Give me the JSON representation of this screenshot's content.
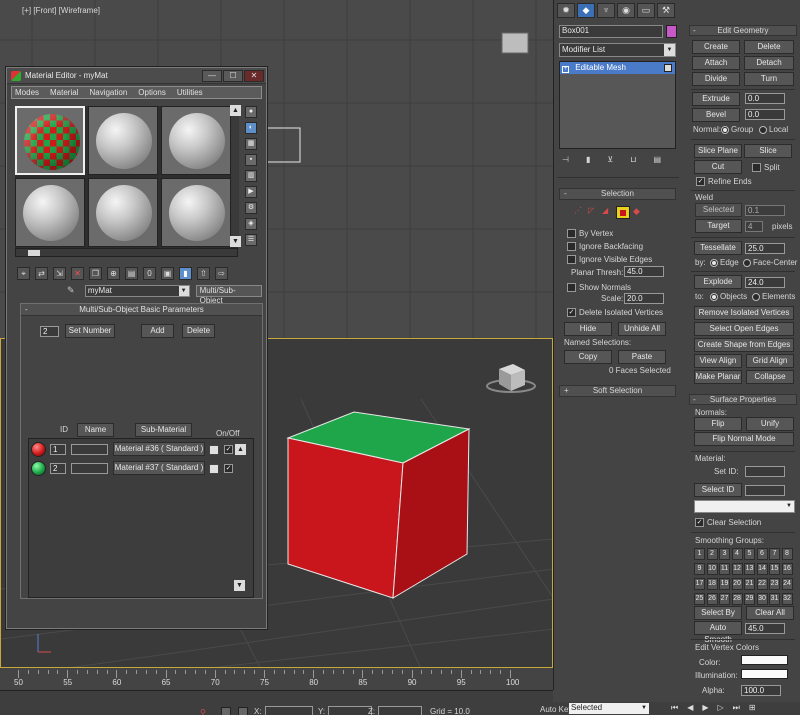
{
  "viewport_front": {
    "label": "[+] [Front] [Wireframe]"
  },
  "material_editor": {
    "title": "Material Editor - myMat",
    "menus": [
      "Modes",
      "Material",
      "Navigation",
      "Options",
      "Utilities"
    ],
    "material_name": "myMat",
    "material_type": "Multi/Sub-Object",
    "panel_title": "Multi/Sub-Object Basic Parameters",
    "count": "2",
    "set_number_label": "Set Number",
    "add_label": "Add",
    "delete_label": "Delete",
    "columns": {
      "id": "ID",
      "name": "Name",
      "submaterial": "Sub-Material",
      "onoff": "On/Off"
    },
    "rows": [
      {
        "id": "1",
        "name": "",
        "submaterial": "Material #36  ( Standard )",
        "ball_color": "#d21a1a"
      },
      {
        "id": "2",
        "name": "",
        "submaterial": "Material #37  ( Standard )",
        "ball_color": "#1fa64a"
      }
    ]
  },
  "command_panel": {
    "object_name": "Box001",
    "object_color": "#c658c8",
    "modifier_list": "Modifier List",
    "stack_item": "Editable Mesh",
    "selection": {
      "title": "Selection",
      "by_vertex": "By Vertex",
      "ignore_backfacing": "Ignore Backfacing",
      "ignore_visible_edges": "Ignore Visible Edges",
      "planar_thresh_label": "Planar Thresh:",
      "planar_thresh": "45.0",
      "show_normals": "Show Normals",
      "scale_label": "Scale:",
      "scale": "20.0",
      "delete_isolated": "Delete Isolated Vertices",
      "hide": "Hide",
      "unhide_all": "Unhide All",
      "named_selections": "Named Selections:",
      "copy": "Copy",
      "paste": "Paste",
      "faces_selected": "0 Faces Selected"
    },
    "soft_selection": "Soft Selection",
    "edit_geometry": {
      "title": "Edit Geometry",
      "create": "Create",
      "delete": "Delete",
      "attach": "Attach",
      "detach": "Detach",
      "divide": "Divide",
      "turn": "Turn",
      "extrude": "Extrude",
      "extrude_val": "0.0",
      "bevel": "Bevel",
      "bevel_val": "0.0",
      "normal_label": "Normal:",
      "group": "Group",
      "local": "Local",
      "slice_plane": "Slice Plane",
      "slice": "Slice",
      "cut": "Cut",
      "split": "Split",
      "refine_ends": "Refine Ends",
      "weld": "Weld",
      "selected": "Selected",
      "selected_val": "0.1",
      "target": "Target",
      "target_val": "4",
      "pixels": "pixels",
      "tessellate": "Tessellate",
      "tessellate_val": "25.0",
      "by_label": "by:",
      "edge": "Edge",
      "face_center": "Face-Center",
      "explode": "Explode",
      "explode_val": "24.0",
      "to_label": "to:",
      "objects": "Objects",
      "elements": "Elements",
      "remove_isolated": "Remove Isolated Vertices",
      "select_open_edges": "Select Open Edges",
      "create_shape": "Create Shape from Edges",
      "view_align": "View Align",
      "grid_align": "Grid Align",
      "make_planar": "Make Planar",
      "collapse": "Collapse"
    },
    "surface": {
      "title": "Surface Properties",
      "normals": "Normals:",
      "flip": "Flip",
      "unify": "Unify",
      "flip_normal_mode": "Flip Normal Mode",
      "material": "Material:",
      "set_id": "Set ID:",
      "select_id": "Select ID",
      "clear_selection": "Clear Selection",
      "smoothing_groups": "Smoothing Groups:",
      "sg": [
        "1",
        "2",
        "3",
        "4",
        "5",
        "6",
        "7",
        "8",
        "9",
        "10",
        "11",
        "12",
        "13",
        "14",
        "15",
        "16",
        "17",
        "18",
        "19",
        "20",
        "21",
        "22",
        "23",
        "24",
        "25",
        "26",
        "27",
        "28",
        "29",
        "30",
        "31",
        "32"
      ],
      "select_by_sg": "Select By SG",
      "clear_all": "Clear All",
      "auto_smooth": "Auto Smooth",
      "auto_smooth_val": "45.0",
      "edit_vertex_colors": "Edit Vertex Colors",
      "color": "Color:",
      "illumination": "Illumination:",
      "alpha": "Alpha:",
      "alpha_val": "100.0"
    }
  },
  "timeline": {
    "ticks": [
      "50",
      "55",
      "60",
      "65",
      "70",
      "75",
      "80",
      "85",
      "90",
      "95",
      "100"
    ]
  },
  "status": {
    "x_label": "X:",
    "y_label": "Y:",
    "z_label": "Z:",
    "grid": "Grid = 10.0",
    "auto_key": "Auto Key",
    "selected": "Selected"
  },
  "colors": {
    "cube_red": "#c8161c",
    "cube_green": "#1fa64a",
    "active_border": "#c9a83b"
  }
}
